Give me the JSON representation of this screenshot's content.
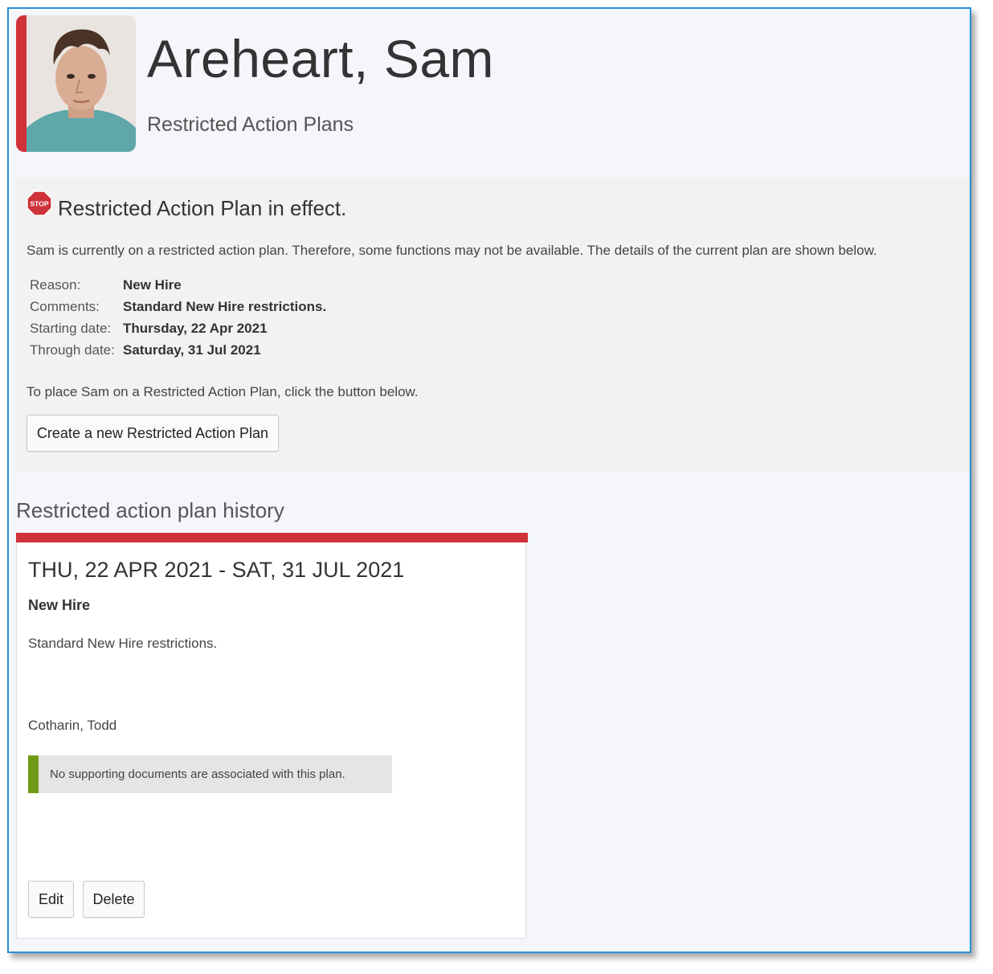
{
  "profile": {
    "name": "Areheart, Sam",
    "subtitle": "Restricted Action Plans"
  },
  "alert": {
    "icon": "stop-sign-icon",
    "icon_text": "STOP",
    "title": "Restricted Action Plan in effect.",
    "description": "Sam is currently on a restricted action plan. Therefore, some functions may not be available. The details of the current plan are shown below.",
    "details": [
      {
        "label": "Reason:",
        "value": "New Hire"
      },
      {
        "label": "Comments:",
        "value": "Standard New Hire restrictions."
      },
      {
        "label": "Starting date:",
        "value": "Thursday, 22 Apr 2021"
      },
      {
        "label": "Through date:",
        "value": "Saturday, 31 Jul 2021"
      }
    ],
    "place_note": "To place Sam on a Restricted Action Plan, click the button below.",
    "create_button": "Create a new Restricted Action Plan"
  },
  "history": {
    "heading": "Restricted action plan history",
    "plans": [
      {
        "date_range": "THU, 22 APR 2021 - SAT, 31 JUL 2021",
        "reason": "New Hire",
        "comment": "Standard New Hire restrictions.",
        "author": "Cotharin, Todd",
        "documents_note": "No supporting documents are associated with this plan.",
        "edit_button": "Edit",
        "delete_button": "Delete"
      }
    ]
  },
  "colors": {
    "accent_red": "#d0323a",
    "doc_bar_green": "#6f9a16",
    "frame_blue": "#2b8fd4"
  }
}
